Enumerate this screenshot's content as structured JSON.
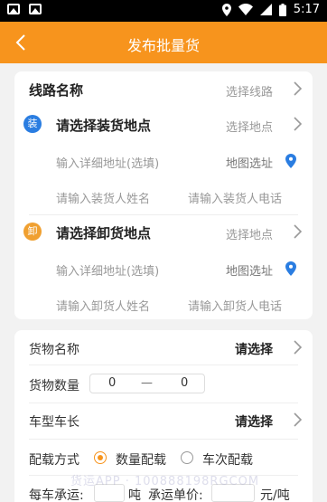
{
  "status_bar": {
    "time": "5:17"
  },
  "header": {
    "title": "发布批量货"
  },
  "route": {
    "label": "线路名称",
    "action": "选择线路"
  },
  "loading": {
    "badge": "装",
    "title": "请选择装货地点",
    "select_action": "选择地点",
    "address_placeholder": "输入详细地址(选填)",
    "map_action": "地图选址",
    "name_placeholder": "请输入装货人姓名",
    "phone_placeholder": "请输入装货人电话"
  },
  "unloading": {
    "badge": "卸",
    "title": "请选择卸货地点",
    "select_action": "选择地点",
    "address_placeholder": "输入详细地址(选填)",
    "map_action": "地图选址",
    "name_placeholder": "请输入卸货人姓名",
    "phone_placeholder": "请输入卸货人电话"
  },
  "cargo": {
    "name_label": "货物名称",
    "name_value": "请选择",
    "qty_label": "货物数量",
    "qty_min": "0",
    "qty_dash": "—",
    "qty_max": "0",
    "vehicle_label": "车型车长",
    "vehicle_value": "请选择",
    "mode_label": "配载方式",
    "mode_options": [
      "数量配载",
      "车次配载"
    ],
    "per_vehicle_label": "每车承运:",
    "per_vehicle_unit": "吨",
    "price_label": "承运单价:",
    "price_unit": "元/吨"
  },
  "watermark": "货运APP · 100888198RGCOM",
  "colors": {
    "accent": "#f7941d",
    "badge_load": "#2a7de1",
    "badge_unload": "#f0a030",
    "map_pin": "#2a7de1"
  }
}
